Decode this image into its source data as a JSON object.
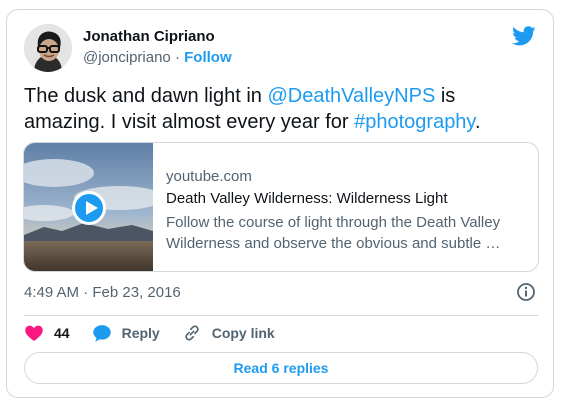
{
  "author": {
    "name": "Jonathan Cipriano",
    "handle": "@joncipriano",
    "separator": "·",
    "follow_label": "Follow"
  },
  "tweet": {
    "text_part1": "The dusk and dawn light in ",
    "mention": "@DeathValleyNPS",
    "text_part2": " is amazing. I visit almost every year for ",
    "hashtag": "#photography",
    "text_part3": "."
  },
  "link_preview": {
    "domain": "youtube.com",
    "title": "Death Valley Wilderness: Wilderness Light",
    "description": "Follow the course of light through the Death Valley Wilderness and observe the obvious and subtle …"
  },
  "meta": {
    "timestamp": "4:49 AM · Feb 23, 2016"
  },
  "actions": {
    "like_count": "44",
    "reply_label": "Reply",
    "copy_link_label": "Copy link"
  },
  "footer": {
    "read_replies_label": "Read 6 replies"
  },
  "icons": {
    "brand": "twitter-bird-icon",
    "info": "info-icon",
    "like": "heart-icon",
    "reply": "speech-bubble-icon",
    "copy": "link-icon",
    "play": "play-icon"
  },
  "colors": {
    "accent": "#1d9bf0",
    "like": "#f91880",
    "text": "#0f1419",
    "muted": "#536471",
    "border": "#cfd9de"
  }
}
